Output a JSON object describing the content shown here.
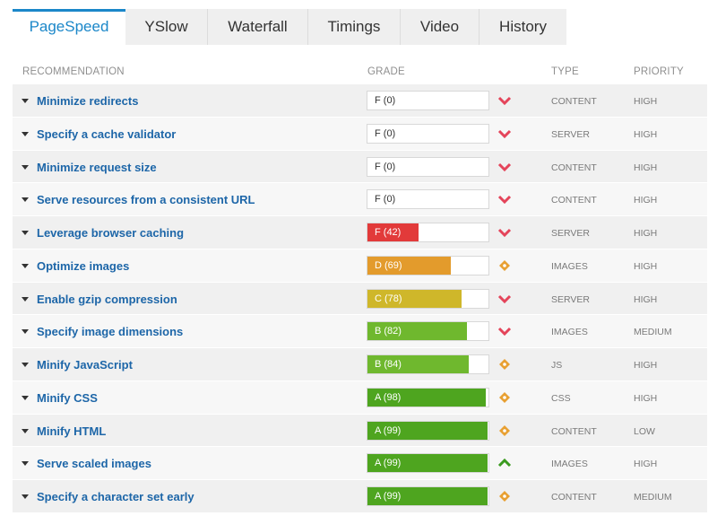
{
  "tabs": [
    {
      "label": "PageSpeed",
      "active": true
    },
    {
      "label": "YSlow",
      "active": false
    },
    {
      "label": "Waterfall",
      "active": false
    },
    {
      "label": "Timings",
      "active": false
    },
    {
      "label": "Video",
      "active": false
    },
    {
      "label": "History",
      "active": false
    }
  ],
  "columns": {
    "recommendation": "RECOMMENDATION",
    "grade": "GRADE",
    "type": "TYPE",
    "priority": "PRIORITY"
  },
  "grade_colors": {
    "F_zero": "#ffffff",
    "F": "#e23a3a",
    "D": "#e39b2c",
    "C": "#cfb72a",
    "B": "#6fb82e",
    "A": "#4ea51f"
  },
  "indicator_colors": {
    "chevron-down": "#e4445a",
    "diamond": "#e8a032",
    "chevron-up": "#3a9a1e"
  },
  "rows": [
    {
      "recommendation": "Minimize redirects",
      "grade": "F (0)",
      "score": 0,
      "letter": "F",
      "indicator": "chevron-down",
      "type": "CONTENT",
      "priority": "HIGH"
    },
    {
      "recommendation": "Specify a cache validator",
      "grade": "F (0)",
      "score": 0,
      "letter": "F",
      "indicator": "chevron-down",
      "type": "SERVER",
      "priority": "HIGH"
    },
    {
      "recommendation": "Minimize request size",
      "grade": "F (0)",
      "score": 0,
      "letter": "F",
      "indicator": "chevron-down",
      "type": "CONTENT",
      "priority": "HIGH"
    },
    {
      "recommendation": "Serve resources from a consistent URL",
      "grade": "F (0)",
      "score": 0,
      "letter": "F",
      "indicator": "chevron-down",
      "type": "CONTENT",
      "priority": "HIGH"
    },
    {
      "recommendation": "Leverage browser caching",
      "grade": "F (42)",
      "score": 42,
      "letter": "F",
      "indicator": "chevron-down",
      "type": "SERVER",
      "priority": "HIGH"
    },
    {
      "recommendation": "Optimize images",
      "grade": "D (69)",
      "score": 69,
      "letter": "D",
      "indicator": "diamond",
      "type": "IMAGES",
      "priority": "HIGH"
    },
    {
      "recommendation": "Enable gzip compression",
      "grade": "C (78)",
      "score": 78,
      "letter": "C",
      "indicator": "chevron-down",
      "type": "SERVER",
      "priority": "HIGH"
    },
    {
      "recommendation": "Specify image dimensions",
      "grade": "B (82)",
      "score": 82,
      "letter": "B",
      "indicator": "chevron-down",
      "type": "IMAGES",
      "priority": "MEDIUM"
    },
    {
      "recommendation": "Minify JavaScript",
      "grade": "B (84)",
      "score": 84,
      "letter": "B",
      "indicator": "diamond",
      "type": "JS",
      "priority": "HIGH"
    },
    {
      "recommendation": "Minify CSS",
      "grade": "A (98)",
      "score": 98,
      "letter": "A",
      "indicator": "diamond",
      "type": "CSS",
      "priority": "HIGH"
    },
    {
      "recommendation": "Minify HTML",
      "grade": "A (99)",
      "score": 99,
      "letter": "A",
      "indicator": "diamond",
      "type": "CONTENT",
      "priority": "LOW"
    },
    {
      "recommendation": "Serve scaled images",
      "grade": "A (99)",
      "score": 99,
      "letter": "A",
      "indicator": "chevron-up",
      "type": "IMAGES",
      "priority": "HIGH"
    },
    {
      "recommendation": "Specify a character set early",
      "grade": "A (99)",
      "score": 99,
      "letter": "A",
      "indicator": "diamond",
      "type": "CONTENT",
      "priority": "MEDIUM"
    }
  ]
}
